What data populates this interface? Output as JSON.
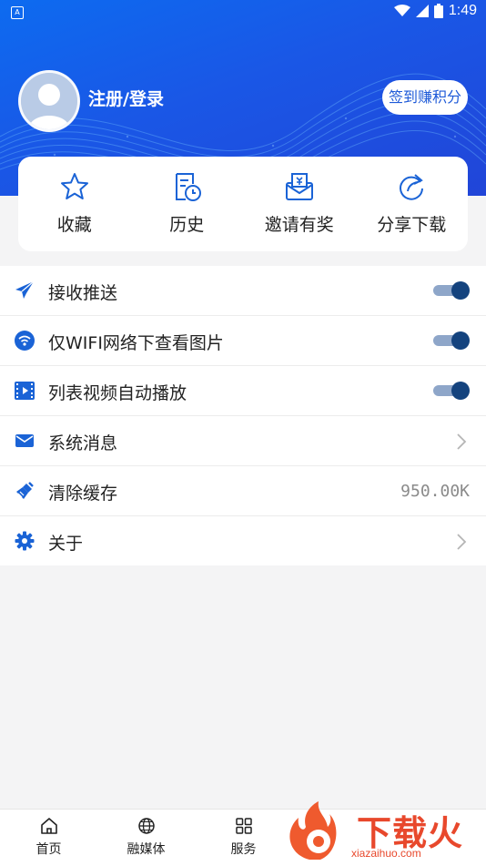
{
  "status_bar": {
    "time": "1:49"
  },
  "header": {
    "login_label": "注册/登录",
    "checkin_button": "签到赚积分"
  },
  "quick_actions": [
    {
      "label": "收藏",
      "icon": "star-icon"
    },
    {
      "label": "历史",
      "icon": "history-icon"
    },
    {
      "label": "邀请有奖",
      "icon": "invite-icon"
    },
    {
      "label": "分享下载",
      "icon": "share-icon"
    }
  ],
  "settings": [
    {
      "label": "接收推送",
      "icon": "send-icon",
      "toggle": true
    },
    {
      "label": "仅WIFI网络下查看图片",
      "icon": "wifi-icon",
      "toggle": true
    },
    {
      "label": "列表视频自动播放",
      "icon": "video-icon",
      "toggle": true
    },
    {
      "label": "系统消息",
      "icon": "mail-icon"
    },
    {
      "label": "清除缓存",
      "icon": "broom-icon",
      "value": "950.00K"
    },
    {
      "label": "关于",
      "icon": "gear-icon"
    }
  ],
  "bottom_nav": [
    {
      "label": "首页",
      "icon": "home-icon"
    },
    {
      "label": "融媒体",
      "icon": "globe-icon"
    },
    {
      "label": "服务",
      "icon": "grid-icon"
    }
  ],
  "watermark": {
    "text": "下载火",
    "url": "xiazaihuo.com"
  },
  "colors": {
    "accent": "#1e5ad8",
    "icon_blue": "#1a63d6",
    "toggle_on": "#14437e"
  }
}
